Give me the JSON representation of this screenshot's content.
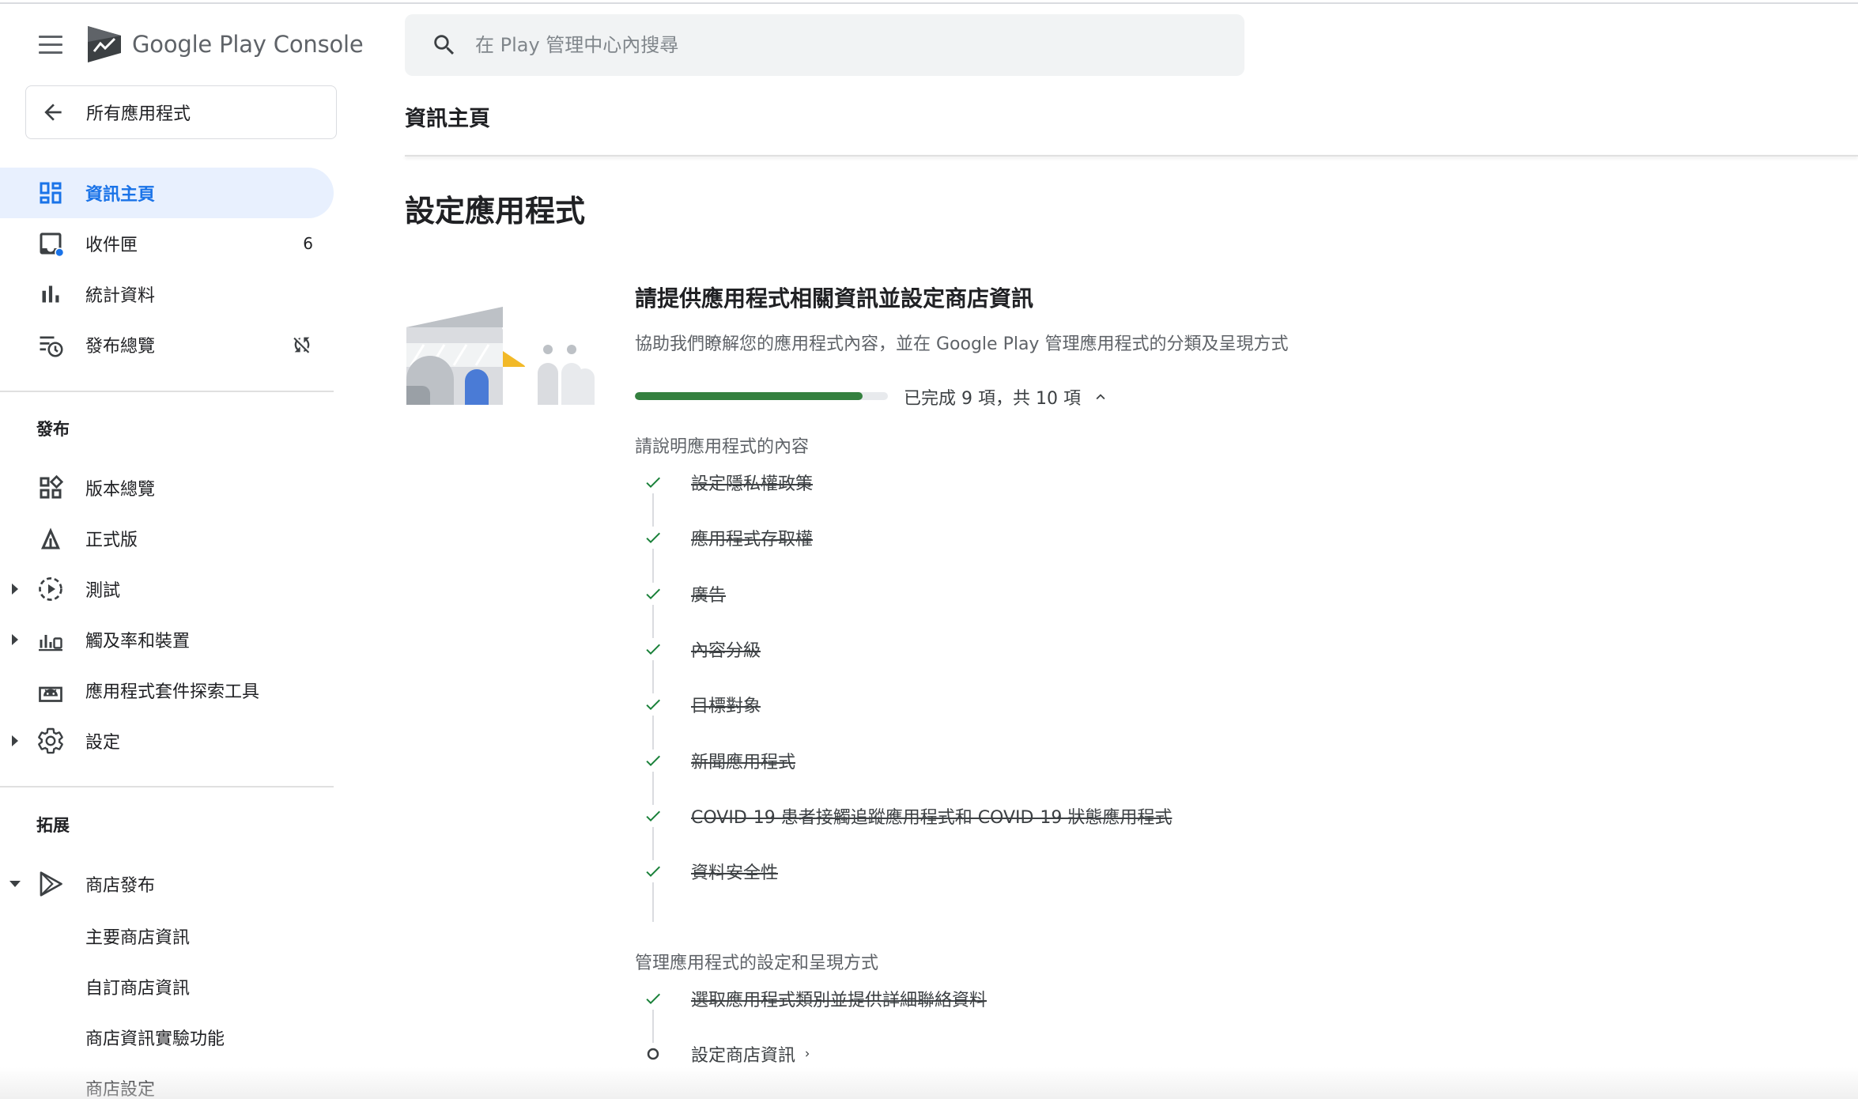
{
  "brand": {
    "google": "Google Play",
    "console": "Console"
  },
  "back": {
    "label": "所有應用程式"
  },
  "nav": {
    "dashboard": "資訊主頁",
    "inbox": "收件匣",
    "inbox_count": "6",
    "statistics": "統計資料",
    "publishing_overview": "發布總覽"
  },
  "sections": {
    "release": "發布",
    "grow": "拓展"
  },
  "release_items": {
    "releases_overview": "版本總覽",
    "production": "正式版",
    "testing": "測試",
    "reach_devices": "觸及率和裝置",
    "app_bundle_explorer": "應用程式套件探索工具",
    "setup": "設定"
  },
  "grow_items": {
    "store_presence": "商店發布",
    "main_listing": "主要商店資訊",
    "custom_listings": "自訂商店資訊",
    "listing_experiments": "商店資訊實驗功能",
    "store_settings": "商店設定"
  },
  "search": {
    "placeholder": "在 Play 管理中心內搜尋"
  },
  "page_title": "資訊主頁",
  "main": {
    "section_title": "設定應用程式",
    "card_title": "請提供應用程式相關資訊並設定商店資訊",
    "card_desc": "協助我們瞭解您的應用程式內容，並在 Google Play 管理應用程式的分類及呈現方式",
    "progress_text": "已完成 9 項，共 10 項",
    "progress_fraction": 0.9,
    "group1_title": "請說明應用程式的內容",
    "group1_tasks": [
      "設定隱私權政策",
      "應用程式存取權",
      "廣告",
      "內容分級",
      "目標對象",
      "新聞應用程式",
      "COVID-19 患者接觸追蹤應用程式和 COVID-19 狀態應用程式",
      "資料安全性"
    ],
    "group2_title": "管理應用程式的設定和呈現方式",
    "group2_tasks": [
      "選取應用程式類別並提供詳細聯絡資料",
      "設定商店資訊"
    ]
  },
  "colors": {
    "accent": "#1a73e8",
    "active_bg": "#e8f0fe",
    "progress": "#34803f",
    "check": "#188038"
  }
}
